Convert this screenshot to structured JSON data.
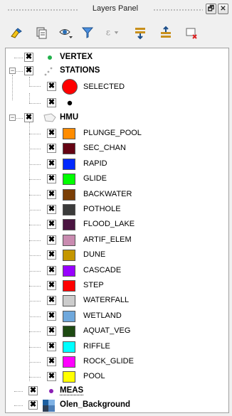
{
  "panel": {
    "title": "Layers Panel",
    "float_button": "🗗",
    "close_button": "✕"
  },
  "toolbar": {
    "items": [
      "open-layer-styling-icon",
      "add-group-icon",
      "manage-visibility-icon",
      "filter-legend-icon",
      "filter-expression-icon",
      "expand-all-icon",
      "collapse-all-icon",
      "remove-layer-icon"
    ]
  },
  "layers": {
    "vertex": {
      "name": "VERTEX",
      "color": "#22b14c"
    },
    "stations": {
      "name": "STATIONS",
      "classes": [
        {
          "label": "SELECTED",
          "color": "#ff0000"
        },
        {
          "label": "",
          "color": "#000000"
        }
      ]
    },
    "hmu": {
      "name": "HMU",
      "classes": [
        {
          "label": "PLUNGE_POOL",
          "color": "#ff8c00"
        },
        {
          "label": "SEC_CHAN",
          "color": "#650313"
        },
        {
          "label": "RAPID",
          "color": "#0028ff"
        },
        {
          "label": "GLIDE",
          "color": "#00ff00"
        },
        {
          "label": "BACKWATER",
          "color": "#7a3e05"
        },
        {
          "label": "POTHOLE",
          "color": "#3b3b3b"
        },
        {
          "label": "FLOOD_LAKE",
          "color": "#4a1440"
        },
        {
          "label": "ARTIF_ELEM",
          "color": "#c98bb0"
        },
        {
          "label": "DUNE",
          "color": "#c49600"
        },
        {
          "label": "CASCADE",
          "color": "#9800ff"
        },
        {
          "label": "STEP",
          "color": "#ff0000"
        },
        {
          "label": "WATERFALL",
          "color": "#cccccc"
        },
        {
          "label": "WETLAND",
          "color": "#6fa8dc"
        },
        {
          "label": "AQUAT_VEG",
          "color": "#1e4a12"
        },
        {
          "label": "RIFFLE",
          "color": "#00ffff"
        },
        {
          "label": "ROCK_GLIDE",
          "color": "#ff00ff"
        },
        {
          "label": "POOL",
          "color": "#ffff00"
        }
      ]
    },
    "meas": {
      "name": "MEAS",
      "color": "#8a1eb4"
    },
    "background": {
      "name": "Olen_Background"
    }
  },
  "checkbox_mark": "✖",
  "expander": {
    "expanded": "−"
  }
}
